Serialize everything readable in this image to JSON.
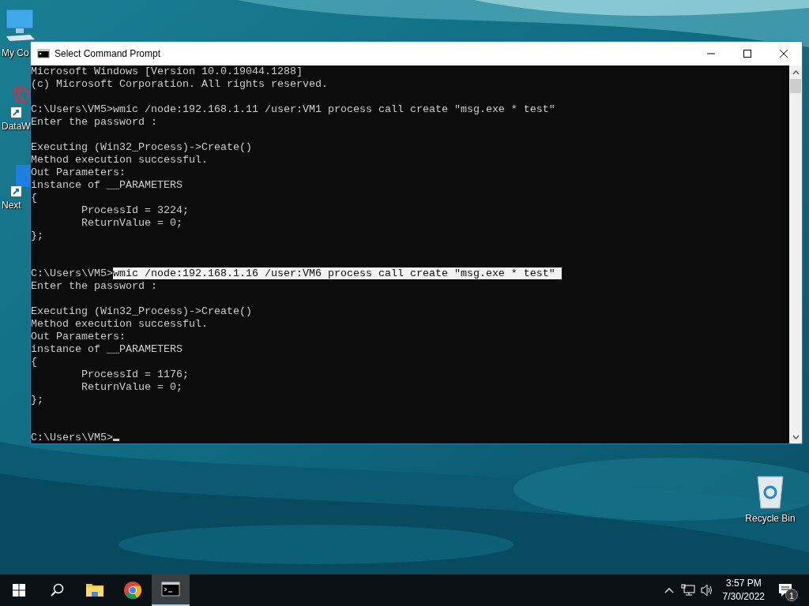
{
  "desktop_icons": [
    {
      "kind": "computer",
      "label": "My Co"
    },
    {
      "kind": "network",
      "label": "DataW",
      "shortcut": true
    },
    {
      "kind": "app",
      "label": "Next",
      "shortcut": true
    },
    {
      "kind": "recycle",
      "label": "Recycle Bin"
    }
  ],
  "window": {
    "title": "Select Command Prompt",
    "lines": [
      {
        "kind": "text",
        "text": "Microsoft Windows [Version 10.0.19044.1288]"
      },
      {
        "kind": "text",
        "text": "(c) Microsoft Corporation. All rights reserved."
      },
      {
        "kind": "blank"
      },
      {
        "kind": "command",
        "prompt": "C:\\Users\\VM5>",
        "command": "wmic /node:192.168.1.11 /user:VM1 process call create \"msg.exe * test\"",
        "selected": false
      },
      {
        "kind": "text",
        "text": "Enter the password :"
      },
      {
        "kind": "blank"
      },
      {
        "kind": "text",
        "text": "Executing (Win32_Process)->Create()"
      },
      {
        "kind": "text",
        "text": "Method execution successful."
      },
      {
        "kind": "text",
        "text": "Out Parameters:"
      },
      {
        "kind": "text",
        "text": "instance of __PARAMETERS"
      },
      {
        "kind": "text",
        "text": "{"
      },
      {
        "kind": "text",
        "text": "        ProcessId = 3224;"
      },
      {
        "kind": "text",
        "text": "        ReturnValue = 0;"
      },
      {
        "kind": "text",
        "text": "};"
      },
      {
        "kind": "blank"
      },
      {
        "kind": "blank"
      },
      {
        "kind": "command",
        "prompt": "C:\\Users\\VM5>",
        "command": "wmic /node:192.168.1.16 /user:VM6 process call create \"msg.exe * test\"",
        "selected": true
      },
      {
        "kind": "text",
        "text": "Enter the password :"
      },
      {
        "kind": "blank"
      },
      {
        "kind": "text",
        "text": "Executing (Win32_Process)->Create()"
      },
      {
        "kind": "text",
        "text": "Method execution successful."
      },
      {
        "kind": "text",
        "text": "Out Parameters:"
      },
      {
        "kind": "text",
        "text": "instance of __PARAMETERS"
      },
      {
        "kind": "text",
        "text": "{"
      },
      {
        "kind": "text",
        "text": "        ProcessId = 1176;"
      },
      {
        "kind": "text",
        "text": "        ReturnValue = 0;"
      },
      {
        "kind": "text",
        "text": "};"
      },
      {
        "kind": "blank"
      },
      {
        "kind": "blank"
      },
      {
        "kind": "prompt",
        "prompt": "C:\\Users\\VM5>"
      }
    ]
  },
  "taskbar": {
    "apps": [
      {
        "kind": "explorer",
        "selected": false
      },
      {
        "kind": "chrome",
        "selected": false
      },
      {
        "kind": "console",
        "selected": true
      }
    ],
    "time": "3:57 PM",
    "date": "7/30/2022",
    "notification_count": "1"
  }
}
